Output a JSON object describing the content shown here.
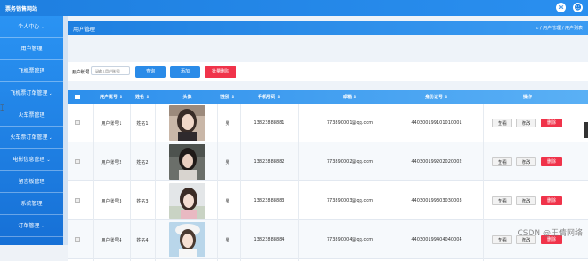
{
  "topbar": {
    "brand": "票务销售网站",
    "icons": [
      "gear-icon",
      "user-icon"
    ]
  },
  "sidebar": {
    "items": [
      {
        "label": "个人中心",
        "chevron": true
      },
      {
        "label": "用户管理",
        "chevron": false
      },
      {
        "label": "飞机票管理",
        "chevron": false
      },
      {
        "label": "飞机票订单管理",
        "chevron": true
      },
      {
        "label": "火车票管理",
        "chevron": false
      },
      {
        "label": "火车票订单管理",
        "chevron": true
      },
      {
        "label": "电影信息管理",
        "chevron": true
      },
      {
        "label": "留言板管理",
        "chevron": false
      },
      {
        "label": "系统管理",
        "chevron": false
      },
      {
        "label": "订单管理",
        "chevron": true
      }
    ]
  },
  "header": {
    "title": "用户管理",
    "breadcrumb": "⌂ / 用户管理 / 用户列表"
  },
  "search": {
    "label": "用户账号",
    "placeholder": "请输入用户账号",
    "query_label": "查询",
    "add_label": "添加",
    "batch_delete_label": "批量删除"
  },
  "table": {
    "columns": [
      "用户账号 ⇕",
      "姓名 ⇕",
      "头像",
      "性别 ⇕",
      "手机号码 ⇕",
      "邮箱 ⇕",
      "身份证号 ⇕",
      "操作"
    ],
    "action_labels": {
      "view": "查看",
      "edit": "修改",
      "delete": "删除"
    },
    "rows": [
      {
        "account": "用户账号1",
        "name": "姓名1",
        "gender": "男",
        "phone": "13823888881",
        "email": "773890001@qq.com",
        "idcard": "440300199101010001"
      },
      {
        "account": "用户账号2",
        "name": "姓名2",
        "gender": "男",
        "phone": "13823888882",
        "email": "773890002@qq.com",
        "idcard": "440300199202020002"
      },
      {
        "account": "用户账号3",
        "name": "姓名3",
        "gender": "男",
        "phone": "13823888883",
        "email": "773890003@qq.com",
        "idcard": "440300199303030003"
      },
      {
        "account": "用户账号4",
        "name": "姓名4",
        "gender": "男",
        "phone": "13823888884",
        "email": "773890004@qq.com",
        "idcard": "440300199404040004"
      }
    ]
  },
  "watermark": "CSDN @王倩网络",
  "colors": {
    "primary": "#1e7fe0",
    "danger": "#f0334a",
    "sidebar": "#2a93f3"
  }
}
